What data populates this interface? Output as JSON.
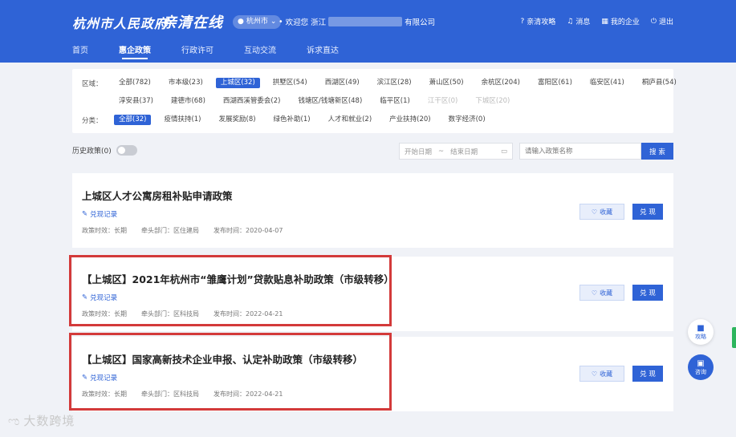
{
  "header": {
    "logo_text": "杭州市人民政府",
    "slogan": "亲清在线",
    "city": "杭州市",
    "welcome_prefix": "欢迎您 浙江",
    "welcome_suffix": "有限公司",
    "links": [
      "亲清攻略",
      "消息",
      "我的企业",
      "退出"
    ]
  },
  "nav": [
    "首页",
    "惠企政策",
    "行政许可",
    "互动交流",
    "诉求直达"
  ],
  "filters": {
    "region_label": "区域：",
    "regions_row1": [
      "全部(782)",
      "市本级(23)",
      "上城区(32)",
      "拱墅区(54)",
      "西湖区(49)",
      "滨江区(28)",
      "萧山区(50)",
      "余杭区(204)",
      "富阳区(61)",
      "临安区(41)",
      "桐庐县(54)"
    ],
    "regions_row2": [
      "淳安县(37)",
      "建德市(68)",
      "西湖西溪管委会(2)",
      "钱塘区/钱塘新区(48)",
      "临平区(1)",
      "江干区(0)",
      "下城区(20)"
    ],
    "category_label": "分类：",
    "categories": [
      "全部(32)",
      "疫情扶持(1)",
      "发展奖励(8)",
      "绿色补助(1)",
      "人才和就业(2)",
      "产业扶持(20)",
      "数字经济(0)"
    ]
  },
  "toolbar": {
    "history_label": "历史政策(0)",
    "start_date": "开始日期",
    "end_date": "结束日期",
    "search_placeholder": "请输入政策名称",
    "search_button": "搜 索"
  },
  "policies": [
    {
      "title": "上城区人才公寓房租补贴申请政策",
      "record": "兑现记录",
      "validity": "政策时效：长期",
      "department": "牵头部门：区住建局",
      "published": "发布时间：2020-04-07",
      "fav_label": "收藏",
      "redeem_label": "兑 现"
    },
    {
      "title": "【上城区】2021年杭州市“雏鹰计划”贷款贴息补助政策（市级转移）",
      "record": "兑现记录",
      "validity": "政策时效：长期",
      "department": "牵头部门：区科技局",
      "published": "发布时间：2022-04-21",
      "fav_label": "收藏",
      "redeem_label": "兑 现"
    },
    {
      "title": "【上城区】国家高新技术企业申报、认定补助政策（市级转移）",
      "record": "兑现记录",
      "validity": "政策时效：长期",
      "department": "牵头部门：区科技局",
      "published": "发布时间：2022-04-21",
      "fav_label": "收藏",
      "redeem_label": "兑 现"
    }
  ],
  "floating": {
    "guide": "攻略",
    "consult": "咨询"
  },
  "watermark": "大数跨境",
  "colors": {
    "primary": "#2f63d6",
    "highlight_border": "#d33a3a"
  }
}
